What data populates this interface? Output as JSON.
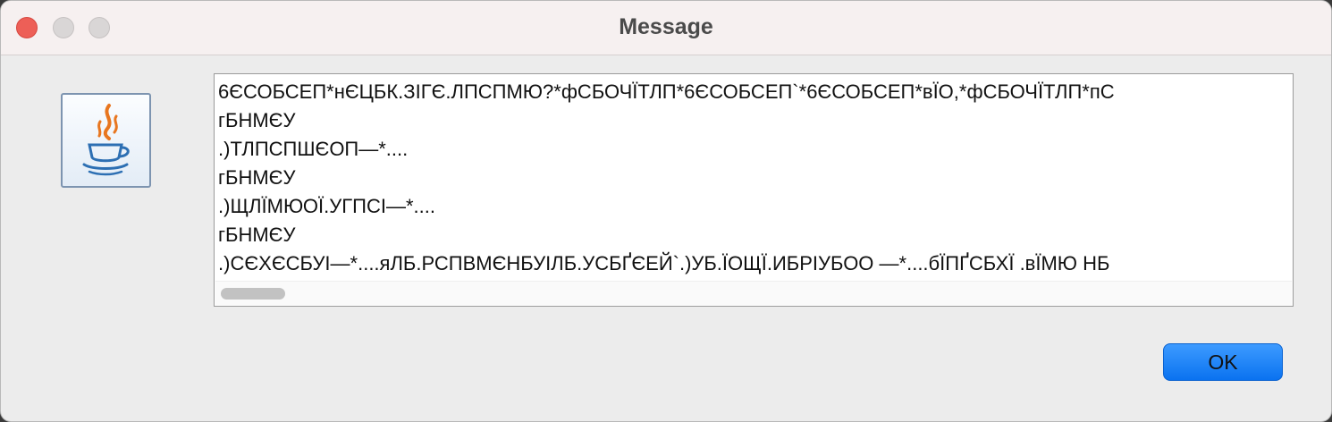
{
  "window": {
    "title": "Message"
  },
  "traffic_lights": {
    "close_color": "#ed5f57",
    "inactive_color": "#d9d6d6"
  },
  "icon": {
    "name": "java-coffee-cup-icon"
  },
  "message": {
    "lines": [
      "6ЄСОБСЕП*нЄЦБК.ЗІГЄ.ЛПСПМЮ?*фСБОЧЇТЛП*6ЄСОБСЕП`*6ЄСОБСЕП*вЇО,*фСБОЧЇТЛП*пС",
      "гБНМЄУ",
      ".)ТЛПСПШЄОП—*....",
      "гБНМЄУ",
      ".)ЩЛЇМЮОЇ.УГПСІ—*....",
      "гБНМЄУ",
      ".)СЄХЄСБУІ—*....яЛБ.РСПВМЄНБУІЛБ.УСБҐЄЕЙ`.)УБ.ЇОЩЇ.ИБРІУБОО —*....бЇПҐСБХЇ .вЇМЮ НБ"
    ]
  },
  "buttons": {
    "ok_label": "OK"
  },
  "colors": {
    "accent": "#0a72f0",
    "titlebar": "#f6f0f0",
    "background": "#ececec"
  }
}
